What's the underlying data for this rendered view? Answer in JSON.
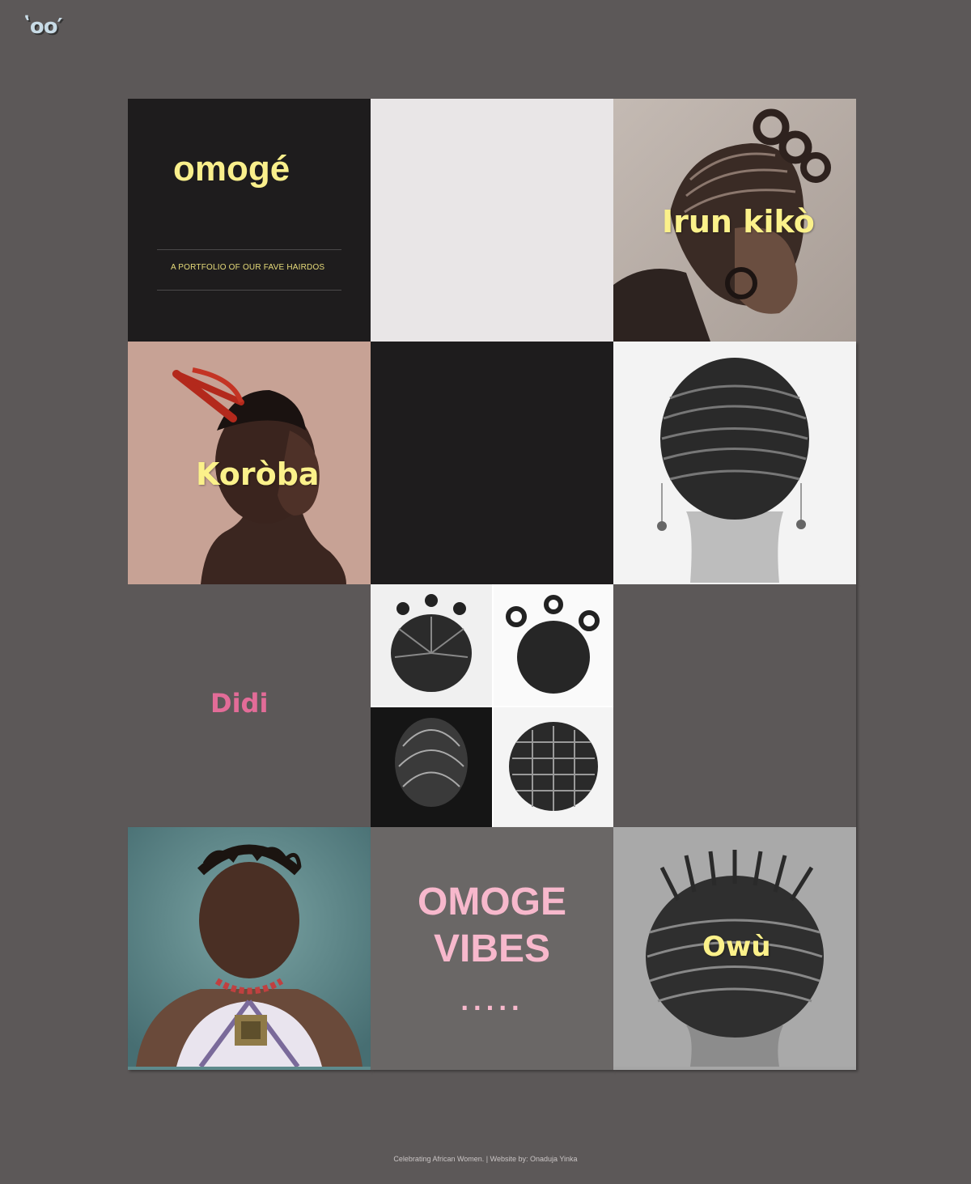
{
  "logo": {
    "text": "ʽoo′"
  },
  "intro": {
    "title": "omogé",
    "tagline": "A PORTFOLIO OF OUR FAVE HAIRDOS"
  },
  "tiles": {
    "irun": {
      "label": "Irun kikò"
    },
    "koroba": {
      "label": "Koròba"
    },
    "didi": {
      "label": "Didi"
    },
    "owu": {
      "label": "Owù"
    },
    "vibes": {
      "line1": "OMOGE",
      "line2": "VIBES",
      "dots": "....."
    }
  },
  "footer": {
    "text": "Celebrating African Women.  | Website by: Onaduja Yinka"
  },
  "colors": {
    "background": "#5c5858",
    "label_yellow": "#fbf18a",
    "didi_pink": "#e36c98",
    "vibes_pink": "#f7b8cc"
  }
}
